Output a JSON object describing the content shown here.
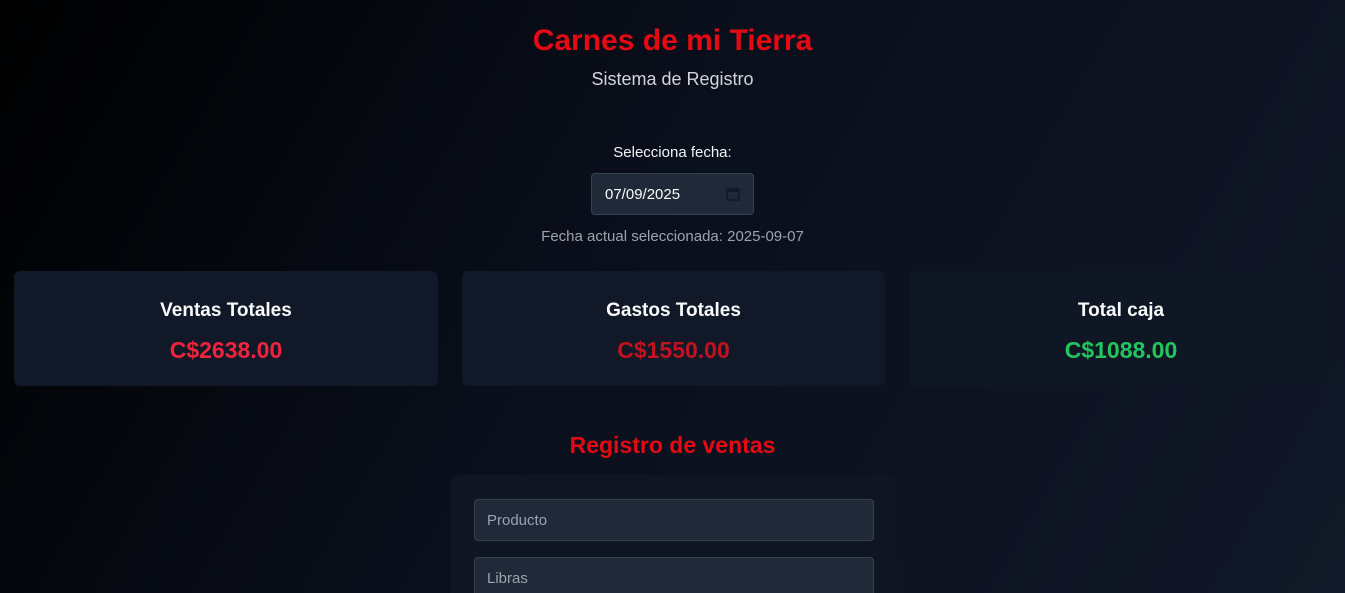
{
  "header": {
    "title": "Carnes de mi Tierra",
    "subtitle": "Sistema de Registro"
  },
  "date_picker": {
    "label": "Selecciona fecha:",
    "value": "07/09/2025",
    "icon": "calendar-icon",
    "current_label": "Fecha actual seleccionada: 2025-09-07"
  },
  "summary": {
    "sales": {
      "title": "Ventas Totales",
      "value": "C$2638.00",
      "color": "#ef233c"
    },
    "expenses": {
      "title": "Gastos Totales",
      "value": "C$1550.00",
      "color": "#c1121f"
    },
    "cash": {
      "title": "Total caja",
      "value": "C$1088.00",
      "color": "#22c55e"
    }
  },
  "sales_form": {
    "title": "Registro de ventas",
    "product_placeholder": "Producto",
    "pounds_placeholder": "Libras"
  },
  "colors": {
    "brand": "#e50914",
    "background": "#000000",
    "card": "#111827"
  }
}
